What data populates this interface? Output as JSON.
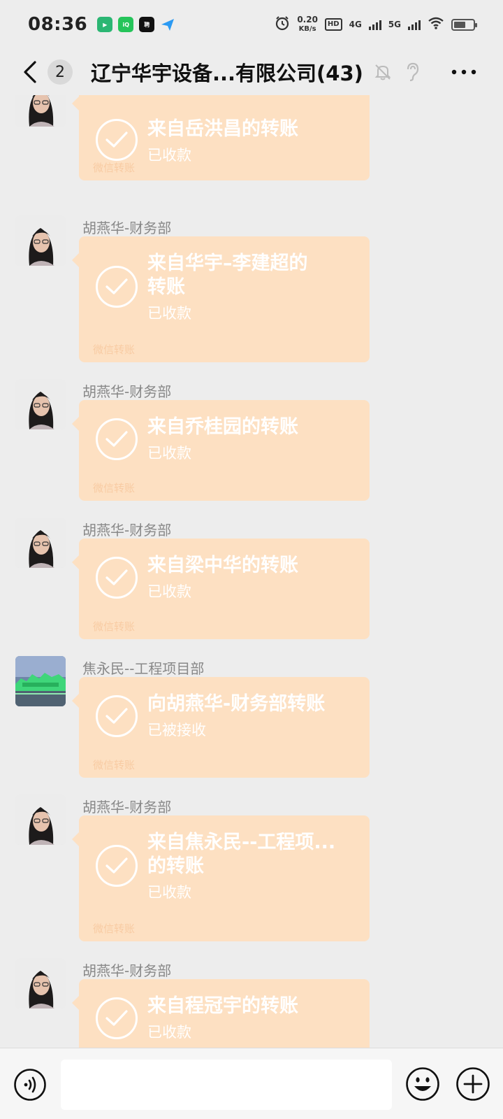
{
  "status_bar": {
    "time": "08:36",
    "net_speed_value": "0.20",
    "net_speed_unit": "KB/s",
    "hd_label": "HD",
    "sim1_label": "4G",
    "sim2_label": "5G",
    "battery_level": 0.6
  },
  "header": {
    "unread_count": "2",
    "title": "辽宁华宇设备...有限公司(43)"
  },
  "messages": [
    {
      "sender": "",
      "title": "来自岳洪昌的转账",
      "status": "已收款",
      "footer": "微信转账",
      "avatar": "woman"
    },
    {
      "sender": "胡燕华-财务部",
      "title": "来自华宇–李建超的转账",
      "status": "已收款",
      "footer": "微信转账",
      "avatar": "woman"
    },
    {
      "sender": "胡燕华-财务部",
      "title": "来自乔桂园的转账",
      "status": "已收款",
      "footer": "微信转账",
      "avatar": "woman"
    },
    {
      "sender": "胡燕华-财务部",
      "title": "来自梁中华的转账",
      "status": "已收款",
      "footer": "微信转账",
      "avatar": "woman"
    },
    {
      "sender": "焦永民--工程项目部",
      "title": "向胡燕华-财务部转账",
      "status": "已被接收",
      "footer": "微信转账",
      "avatar": "landscape"
    },
    {
      "sender": "胡燕华-财务部",
      "title": "来自焦永民--工程项...的转账",
      "status": "已收款",
      "footer": "微信转账",
      "avatar": "woman"
    },
    {
      "sender": "胡燕华-财务部",
      "title": "来自程冠宇的转账",
      "status": "已收款",
      "footer": "",
      "avatar": "woman"
    }
  ],
  "input_bar": {
    "placeholder": ""
  },
  "icons": {
    "back": "chevron-left-icon",
    "mute": "bell-off-icon",
    "earpiece": "ear-icon",
    "more": "more-icon",
    "voice": "voice-icon",
    "emoji": "emoji-icon",
    "plus": "plus-icon",
    "check": "check-circle-icon"
  },
  "colors": {
    "background": "#ededed",
    "bubble": "#fde0c2",
    "bubble_text": "#ffffff"
  }
}
